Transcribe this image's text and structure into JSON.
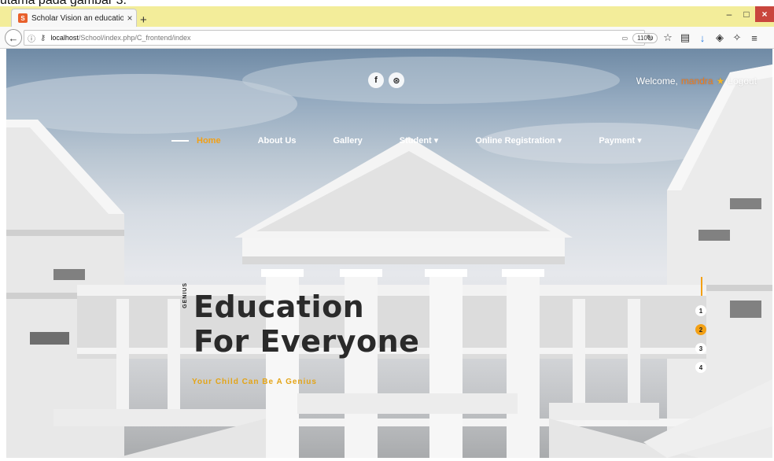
{
  "caption": "utama pada gambar 3.",
  "browser": {
    "tab_title": "Scholar Vision an education",
    "tab_close": "×",
    "new_tab": "+",
    "url_host": "localhost",
    "url_path": "/School/index.php/C_frontend/index",
    "zoom": "110%",
    "win_min": "–",
    "win_max": "□",
    "win_close": "×"
  },
  "site": {
    "social": [
      "f",
      "⊛"
    ],
    "welcome_prefix": "Welcome,",
    "username": "mandra",
    "logout": "Logout",
    "menu": [
      {
        "label": "Home",
        "active": true
      },
      {
        "label": "About Us",
        "active": false
      },
      {
        "label": "Gallery",
        "active": false
      },
      {
        "label": "Student ▾",
        "active": false
      },
      {
        "label": "Online Registration ▾",
        "active": false
      },
      {
        "label": "Payment ▾",
        "active": false
      }
    ],
    "vertical_text": "GENIUS",
    "headline_line1": "Education",
    "headline_line2": "For Everyone",
    "tagline": "Your Child Can Be A Genius",
    "slides": [
      "1",
      "2",
      "3",
      "4"
    ],
    "active_slide": 2
  },
  "colors": {
    "accent": "#f3a014",
    "username": "#f07a1a"
  }
}
